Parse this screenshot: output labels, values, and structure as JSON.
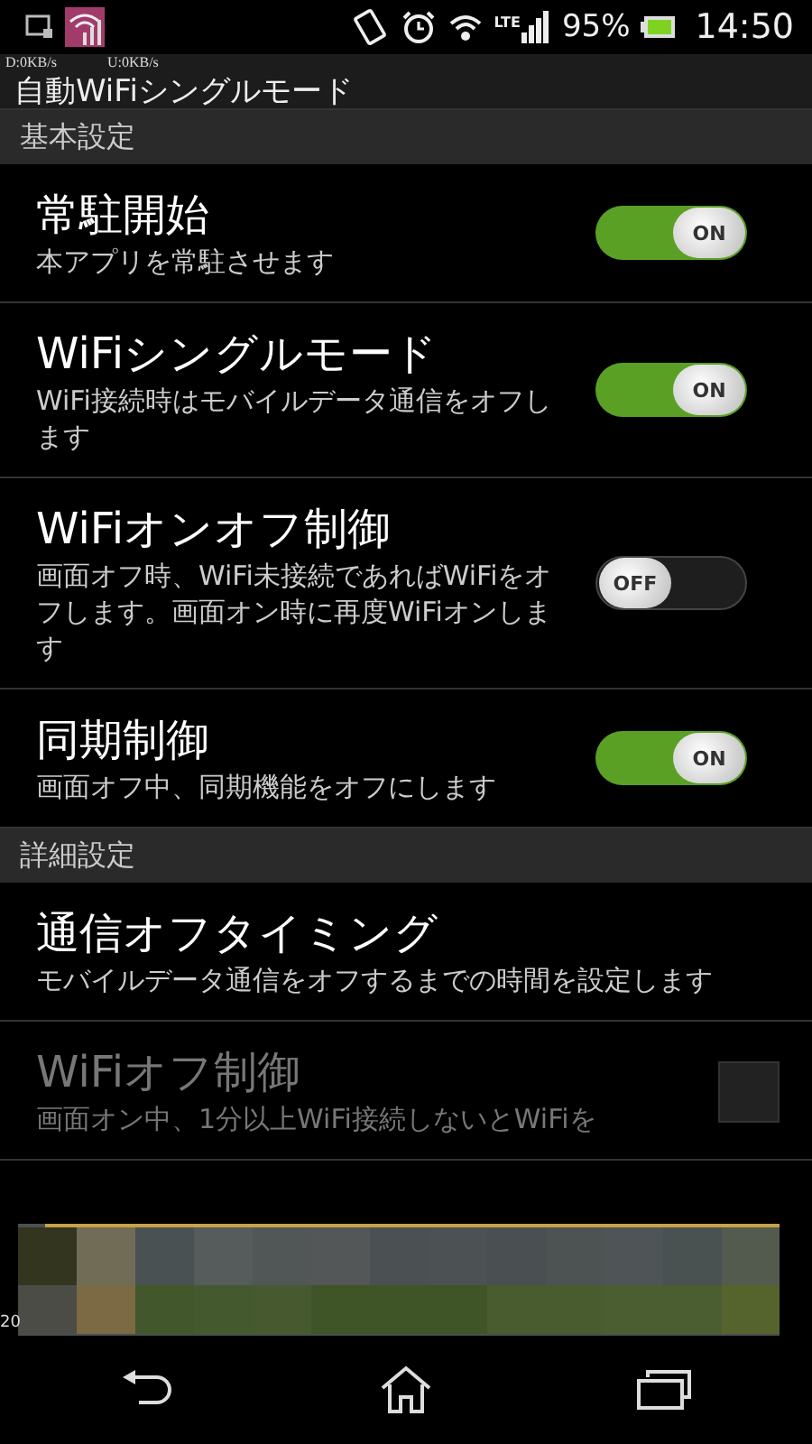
{
  "status_bar": {
    "battery": "95%",
    "time": "14:50",
    "network": "LTE"
  },
  "traffic_overlay": {
    "download": "D:0KB/s",
    "upload": "U:0KB/s"
  },
  "title": "自動WiFiシングルモード",
  "sections": [
    {
      "header": "基本設定",
      "items": [
        {
          "kind": "toggle",
          "title": "常駐開始",
          "summary": "本アプリを常駐させます",
          "label": "ON",
          "on": true,
          "disabled": false
        },
        {
          "kind": "toggle",
          "title": "WiFiシングルモード",
          "summary": "WiFi接続時はモバイルデータ通信をオフします",
          "label": "ON",
          "on": true,
          "disabled": false
        },
        {
          "kind": "toggle",
          "title": "WiFiオンオフ制御",
          "summary": "画面オフ時、WiFi未接続であればWiFiをオフします。画面オン時に再度WiFiオンします",
          "label": "OFF",
          "on": false,
          "disabled": false
        },
        {
          "kind": "toggle",
          "title": "同期制御",
          "summary": "画面オフ中、同期機能をオフにします",
          "label": "ON",
          "on": true,
          "disabled": false
        }
      ]
    },
    {
      "header": "詳細設定",
      "items": [
        {
          "kind": "plain",
          "title": "通信オフタイミング",
          "summary": "モバイルデータ通信をオフするまでの時間を設定します",
          "disabled": false
        },
        {
          "kind": "checkbox",
          "title": "WiFiオフ制御",
          "summary": "画面オン中、1分以上WiFi接続しないとWiFiを",
          "checked": false,
          "disabled": true
        }
      ]
    }
  ],
  "ad_banner": {
    "kind": "picture",
    "corner_text": "20"
  }
}
